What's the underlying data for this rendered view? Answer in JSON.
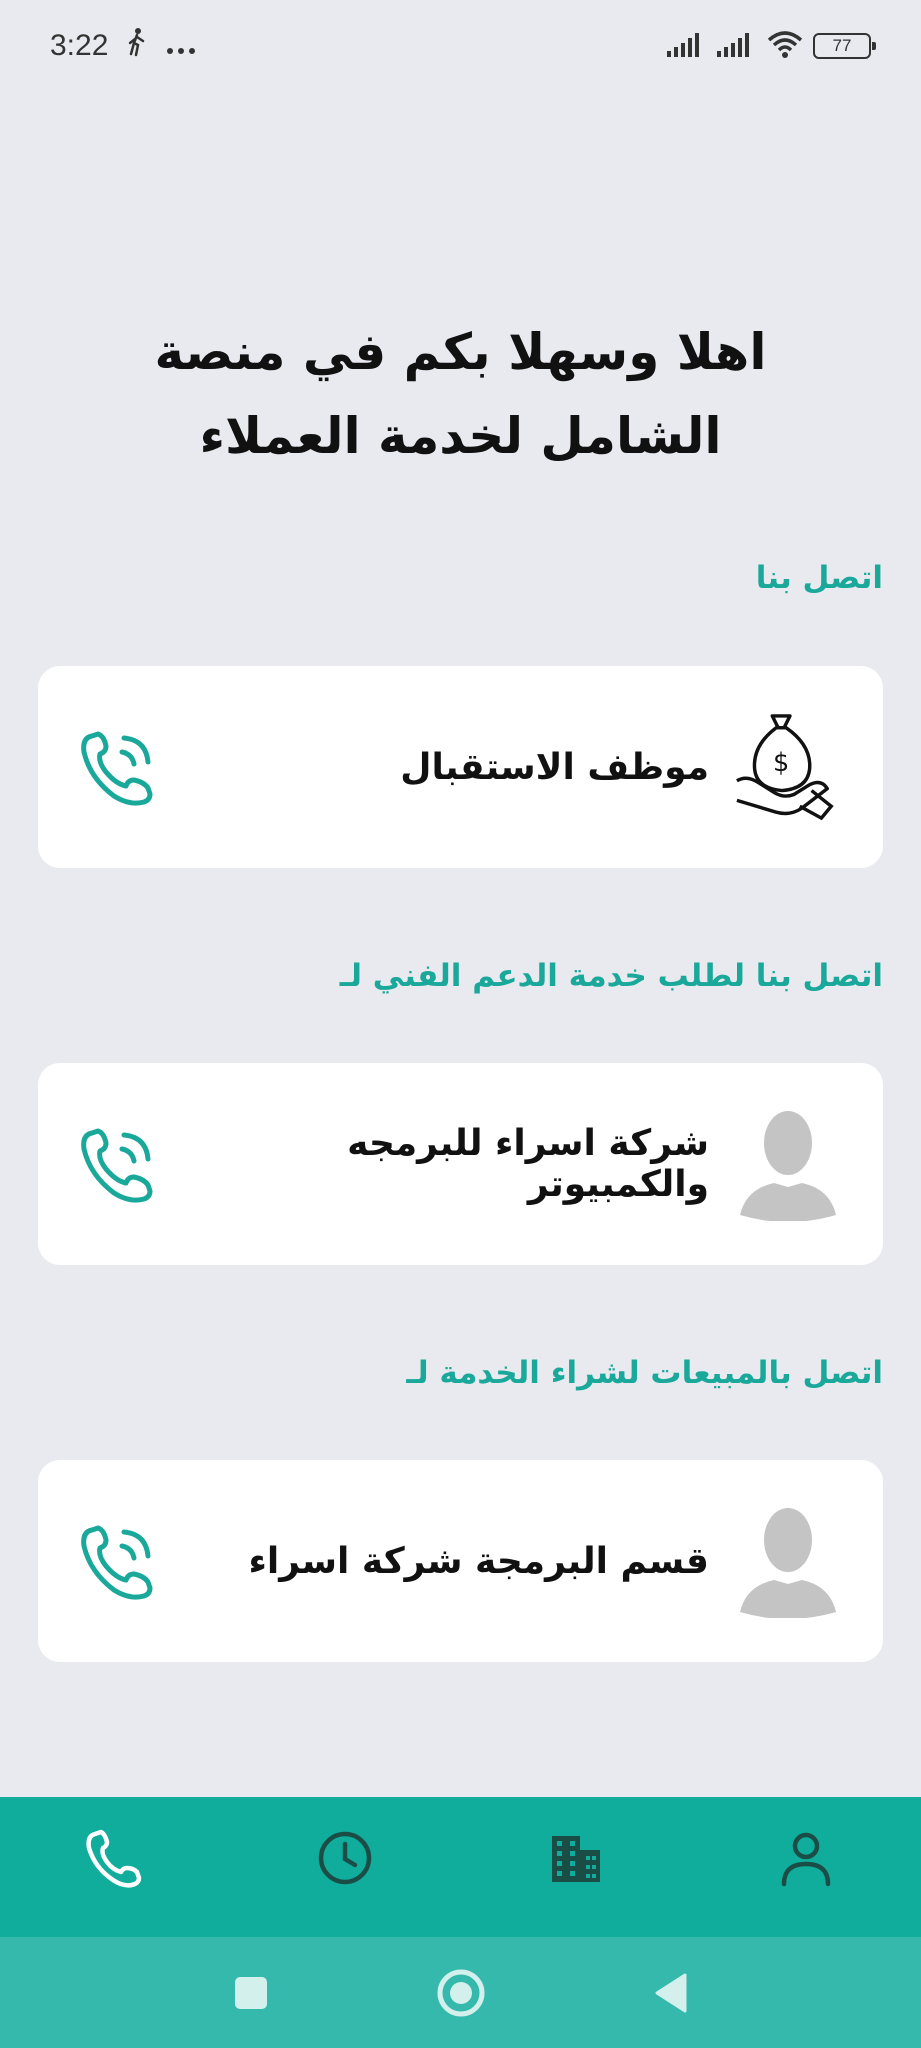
{
  "status_bar": {
    "time": "3:22",
    "battery": "77"
  },
  "welcome": {
    "line1": "اهلا وسهلا بكم في منصة",
    "line2": "الشامل لخدمة العملاء"
  },
  "sections": [
    {
      "title": "اتصل بنا",
      "card_label": "موظف الاستقبال",
      "avatar_icon": "money-bag-hand-icon"
    },
    {
      "title": "اتصل بنا لطلب خدمة الدعم الفني لـ",
      "card_label": "شركة اسراء للبرمجه والكمبيوتر",
      "avatar_icon": "user-silhouette-icon"
    },
    {
      "title": "اتصل بالمبيعات لشراء الخدمة لـ",
      "card_label": "قسم البرمجة شركة اسراء",
      "avatar_icon": "user-silhouette-icon"
    }
  ],
  "bottom_nav": {
    "items": [
      "phone-icon",
      "clock-icon",
      "building-icon",
      "profile-icon"
    ]
  },
  "colors": {
    "accent": "#1aa89b",
    "nav_bg": "#10ad9c",
    "sys_nav_bg": "#36b9ad",
    "page_bg": "#e9eaef"
  }
}
